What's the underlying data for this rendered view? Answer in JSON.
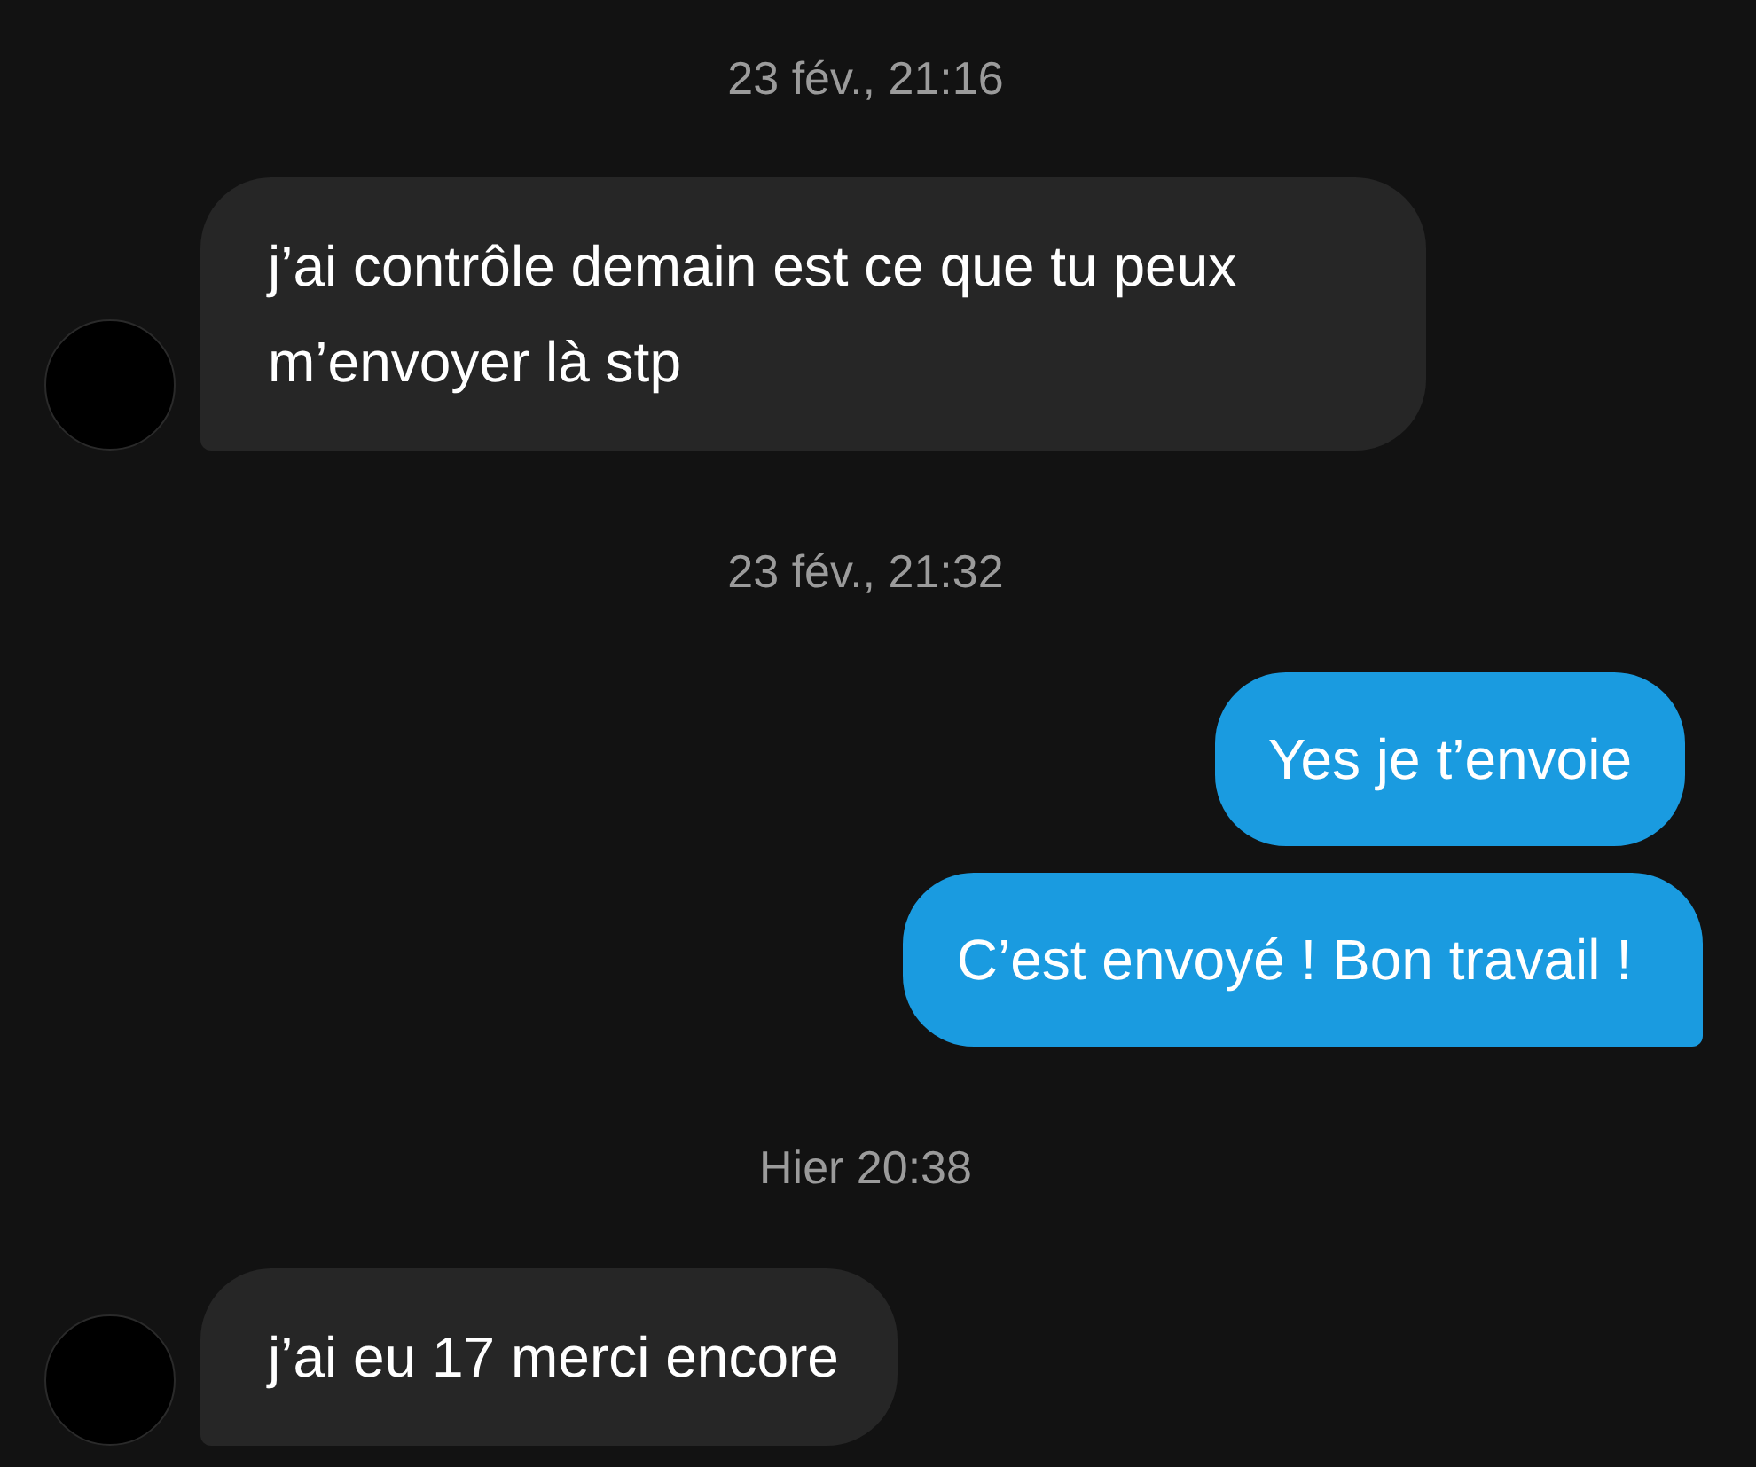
{
  "messages": [
    {
      "kind": "timestamp",
      "text": "23 fév., 21:16"
    },
    {
      "kind": "received",
      "text": "j’ai contrôle demain est ce que tu peux m’envoyer là stp"
    },
    {
      "kind": "timestamp",
      "text": "23 fév., 21:32"
    },
    {
      "kind": "sent",
      "text": "Yes je t’envoie"
    },
    {
      "kind": "sent",
      "text": "C’est envoyé ! Bon travail !"
    },
    {
      "kind": "timestamp",
      "text": "Hier 20:38"
    },
    {
      "kind": "received",
      "text": "j’ai eu 17 merci encore"
    }
  ]
}
